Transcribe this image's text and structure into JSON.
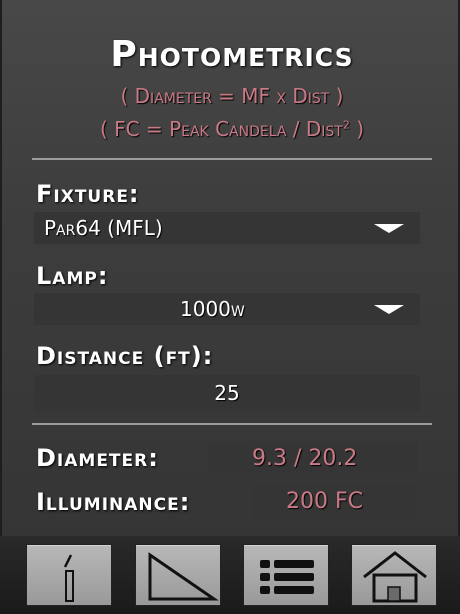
{
  "header": {
    "title": "Photometrics",
    "formula_diameter": "( Diameter = MF x Dist )",
    "formula_fc_prefix": "( FC = Peak Candela / Dist",
    "formula_fc_sup": "2",
    "formula_fc_suffix": " )"
  },
  "fixture": {
    "label": "Fixture:",
    "value": "Par64 (MFL)"
  },
  "lamp": {
    "label": "Lamp:",
    "value": "1000w"
  },
  "distance": {
    "label": "Distance (ft):",
    "value": "25"
  },
  "results": {
    "diameter_label": "Diameter:",
    "diameter_value": "9.3 / 20.2",
    "illuminance_label": "Illuminance:",
    "illuminance_value": "200 FC"
  },
  "toolbar": {
    "buttons": [
      "info-icon",
      "triangle-icon",
      "list-icon",
      "home-icon"
    ]
  },
  "colors": {
    "accent": "#c97a86",
    "text": "#ffffff",
    "background": "#3d3d3d"
  }
}
